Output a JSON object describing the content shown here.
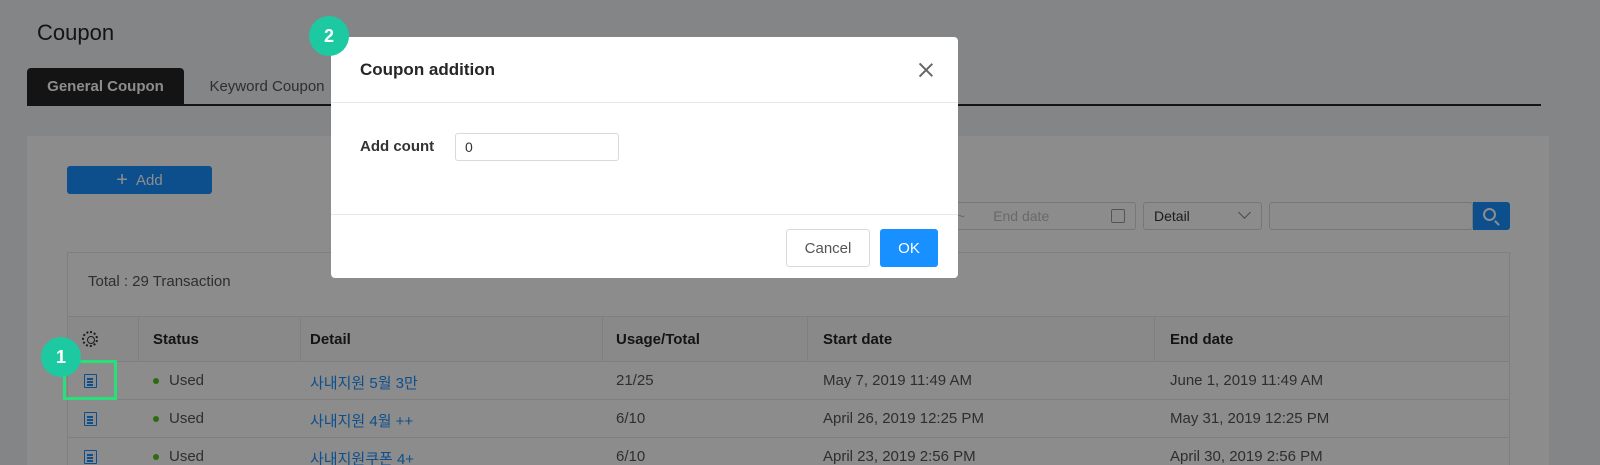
{
  "page": {
    "title": "Coupon"
  },
  "tabs": [
    {
      "label": "General Coupon"
    },
    {
      "label": "Keyword Coupon"
    }
  ],
  "toolbar": {
    "add_label": "Add",
    "date_separator": "~",
    "end_date_placeholder": "End date",
    "detail_select": "Detail",
    "search_value": ""
  },
  "table": {
    "total": "Total : 29 Transaction",
    "columns": [
      "Status",
      "Detail",
      "Usage/Total",
      "Start date",
      "End date"
    ],
    "rows": [
      {
        "status": "Used",
        "detail": "사내지원 5월 3만",
        "usage": "21/25",
        "start": "May 7, 2019 11:49 AM",
        "end": "June 1, 2019 11:49 AM"
      },
      {
        "status": "Used",
        "detail": "사내지원 4월 ++",
        "usage": "6/10",
        "start": "April 26, 2019 12:25 PM",
        "end": "May 31, 2019 12:25 PM"
      },
      {
        "status": "Used",
        "detail": "사내지원쿠폰 4+",
        "usage": "6/10",
        "start": "April 23, 2019 2:56 PM",
        "end": "April 30, 2019 2:56 PM"
      }
    ]
  },
  "modal": {
    "title": "Coupon addition",
    "add_count_label": "Add count",
    "add_count_value": "0",
    "cancel_label": "Cancel",
    "ok_label": "OK"
  },
  "annotations": {
    "badge1": "1",
    "badge2": "2"
  },
  "colors": {
    "primary": "#1890ff",
    "badge": "#1dc9a0",
    "highlight": "#27e07a",
    "status_used": "#52c41a"
  }
}
